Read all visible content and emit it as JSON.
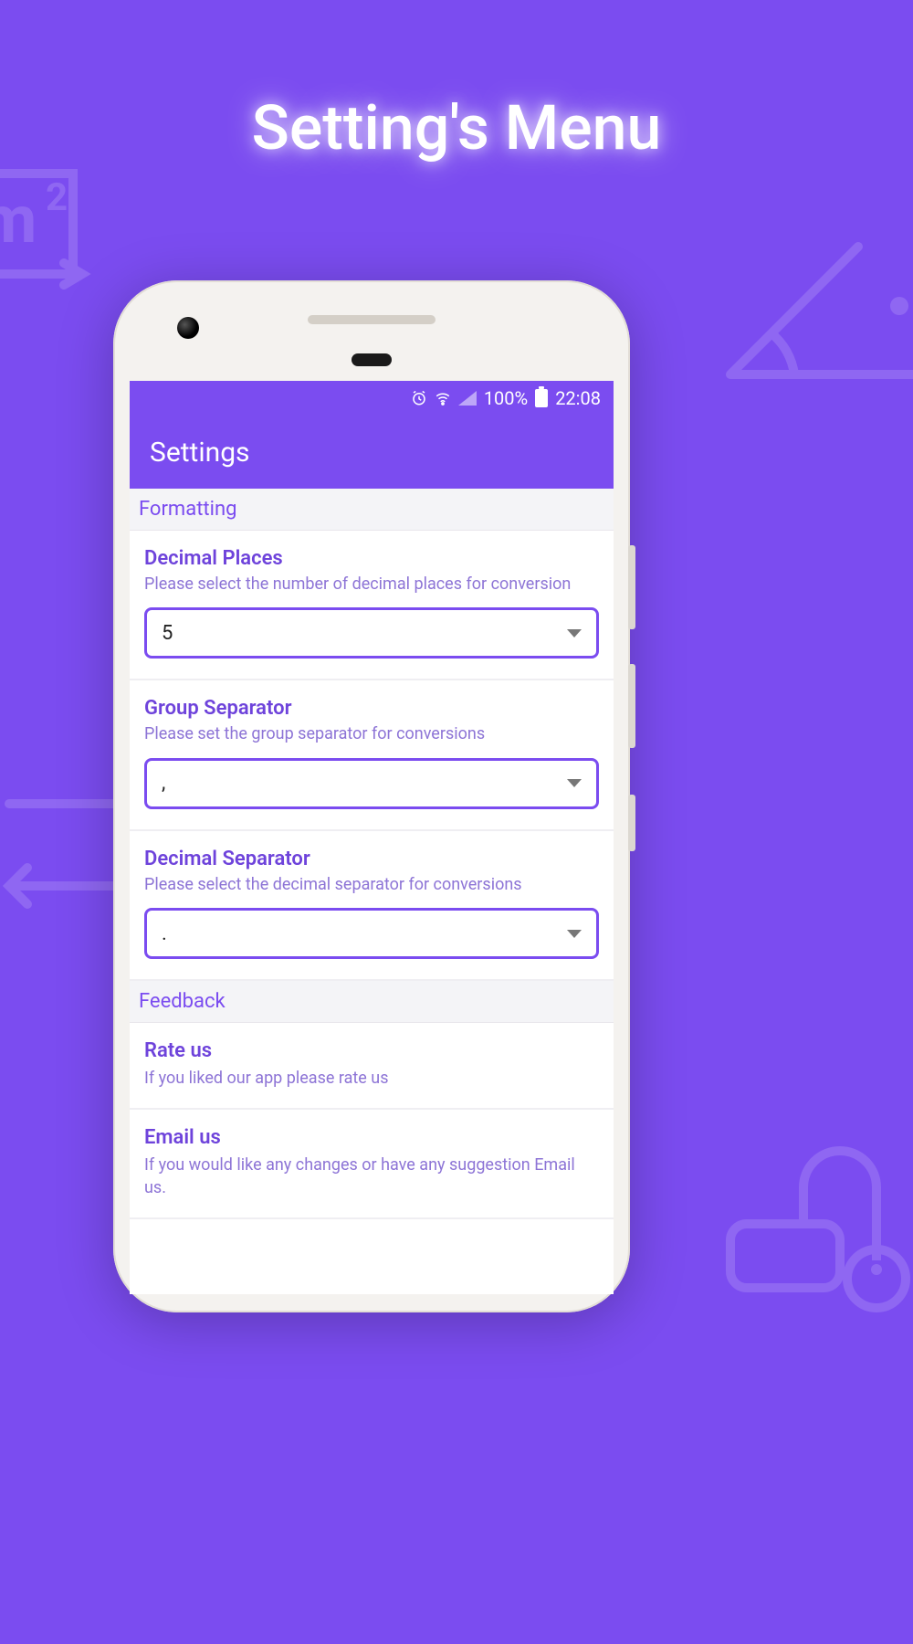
{
  "page_heading": "Setting's Menu",
  "status": {
    "battery_pct": "100%",
    "time": "22:08"
  },
  "appbar": {
    "title": "Settings"
  },
  "sections": {
    "formatting": {
      "header": "Formatting",
      "decimal_places": {
        "title": "Decimal Places",
        "subtitle": "Please select the number of decimal places for conversion",
        "value": "5"
      },
      "group_separator": {
        "title": "Group Separator",
        "subtitle": "Please set the group separator for conversions",
        "value": ","
      },
      "decimal_separator": {
        "title": "Decimal Separator",
        "subtitle": "Please select the decimal separator for conversions",
        "value": "."
      }
    },
    "feedback": {
      "header": "Feedback",
      "rate": {
        "title": "Rate us",
        "subtitle": "If you liked our app please rate us"
      },
      "email": {
        "title": "Email us",
        "subtitle": "If you would like any changes or have any suggestion Email us."
      }
    }
  }
}
